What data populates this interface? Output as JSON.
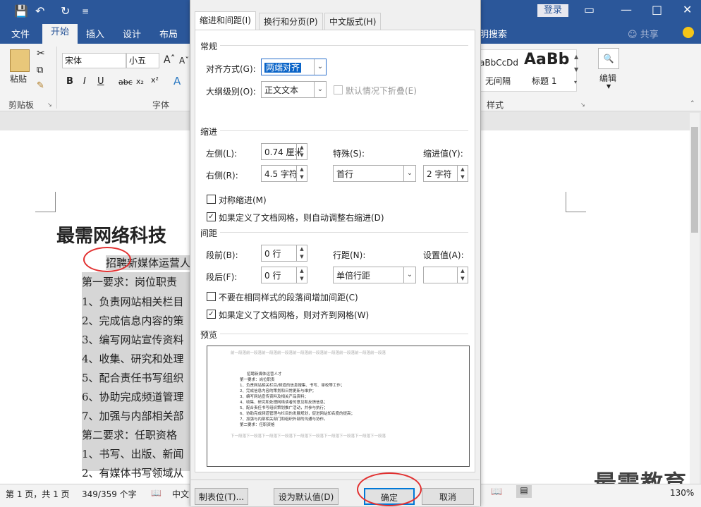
{
  "titlebar": {
    "login_label": "登录"
  },
  "ribbon_tabs": [
    "文件",
    "开始",
    "插入",
    "设计",
    "布局",
    "明搜索",
    "共享"
  ],
  "ribbon": {
    "paste_label": "粘贴",
    "clipboard_group": "剪贴板",
    "font_name": "宋体",
    "font_size": "小五",
    "font_group": "字体",
    "style1_preview": "aBbCcDd",
    "style1_name": "无间隔",
    "style2_preview": "AaBb",
    "style2_name": "标题 1",
    "styles_group": "样式",
    "edit_label": "编辑"
  },
  "document": {
    "title": "最需网络科技",
    "lines": [
      "招聘新媒体运营人",
      "第一要求：岗位职责",
      "1、负责网站相关栏目",
      "2、完成信息内容的策",
      "3、编写网站宣传资料",
      "4、收集、研究和处理",
      "5、配合责任书写组织",
      "6、协助完成频道管理",
      "7、加强与内部相关部",
      "第二要求：任职资格",
      "1、书写、出版、新闻",
      "2、有媒体书写领域从"
    ]
  },
  "statusbar": {
    "page": "第 1 页，共 1 页",
    "words": "349/359 个字",
    "lang": "中文",
    "zoom": "130%"
  },
  "watermark": "最需教育",
  "dialog": {
    "tabs": [
      "缩进和间距(I)",
      "换行和分页(P)",
      "中文版式(H)"
    ],
    "general": {
      "section": "常规",
      "align_label": "对齐方式(G):",
      "align_value": "两端对齐",
      "outline_label": "大纲级别(O):",
      "outline_value": "正文文本",
      "collapse_label": "默认情况下折叠(E)"
    },
    "indent": {
      "section": "缩进",
      "left_label": "左侧(L):",
      "left_value": "0.74 厘米",
      "right_label": "右侧(R):",
      "right_value": "4.5 字符",
      "special_label": "特殊(S):",
      "special_value": "首行",
      "by_label": "缩进值(Y):",
      "by_value": "2 字符",
      "mirror_label": "对称缩进(M)",
      "auto_label": "如果定义了文档网格，则自动调整右缩进(D)"
    },
    "spacing": {
      "section": "间距",
      "before_label": "段前(B):",
      "before_value": "0 行",
      "after_label": "段后(F):",
      "after_value": "0 行",
      "line_label": "行距(N):",
      "line_value": "单倍行距",
      "at_label": "设置值(A):",
      "at_value": "",
      "nospace_label": "不要在相同样式的段落间增加间距(C)",
      "grid_label": "如果定义了文档网格，则对齐到网格(W)"
    },
    "preview": {
      "section": "预览",
      "prev_text": "前一段落前一段落前一段落前一段落前一段落前一段落前一段落前一段落前一段落前一段落",
      "lines": [
        "招聘新媒体运营人才",
        "第一要求：岗位职责",
        "1、负责网站相关栏目/频道的信息搜集、书写、审校等工作；",
        "2、完成信息内容的策划和日常更新与维护；",
        "3、编写网站宣传资料及相关产品资料；",
        "4、收集、研究和处理网络读者的意见和反馈信息；",
        "5、配合责任书写组织策划推广活动，并参与执行；",
        "6、协助完成频道管理与栏目的发展规划，促进网站知名度的提高；",
        "7、加强与内部相关部门和组织外部的沟通与协作。",
        "第二要求：任职资格"
      ],
      "next_text": "下一段落下一段落下一段落下一段落下一段落下一段落下一段落下一段落下一段落下一段落"
    },
    "buttons": {
      "tabs": "制表位(T)...",
      "default": "设为默认值(D)",
      "ok": "确定",
      "cancel": "取消"
    }
  },
  "colors": {
    "accent": "#2b579a",
    "highlight": "#e23030"
  }
}
